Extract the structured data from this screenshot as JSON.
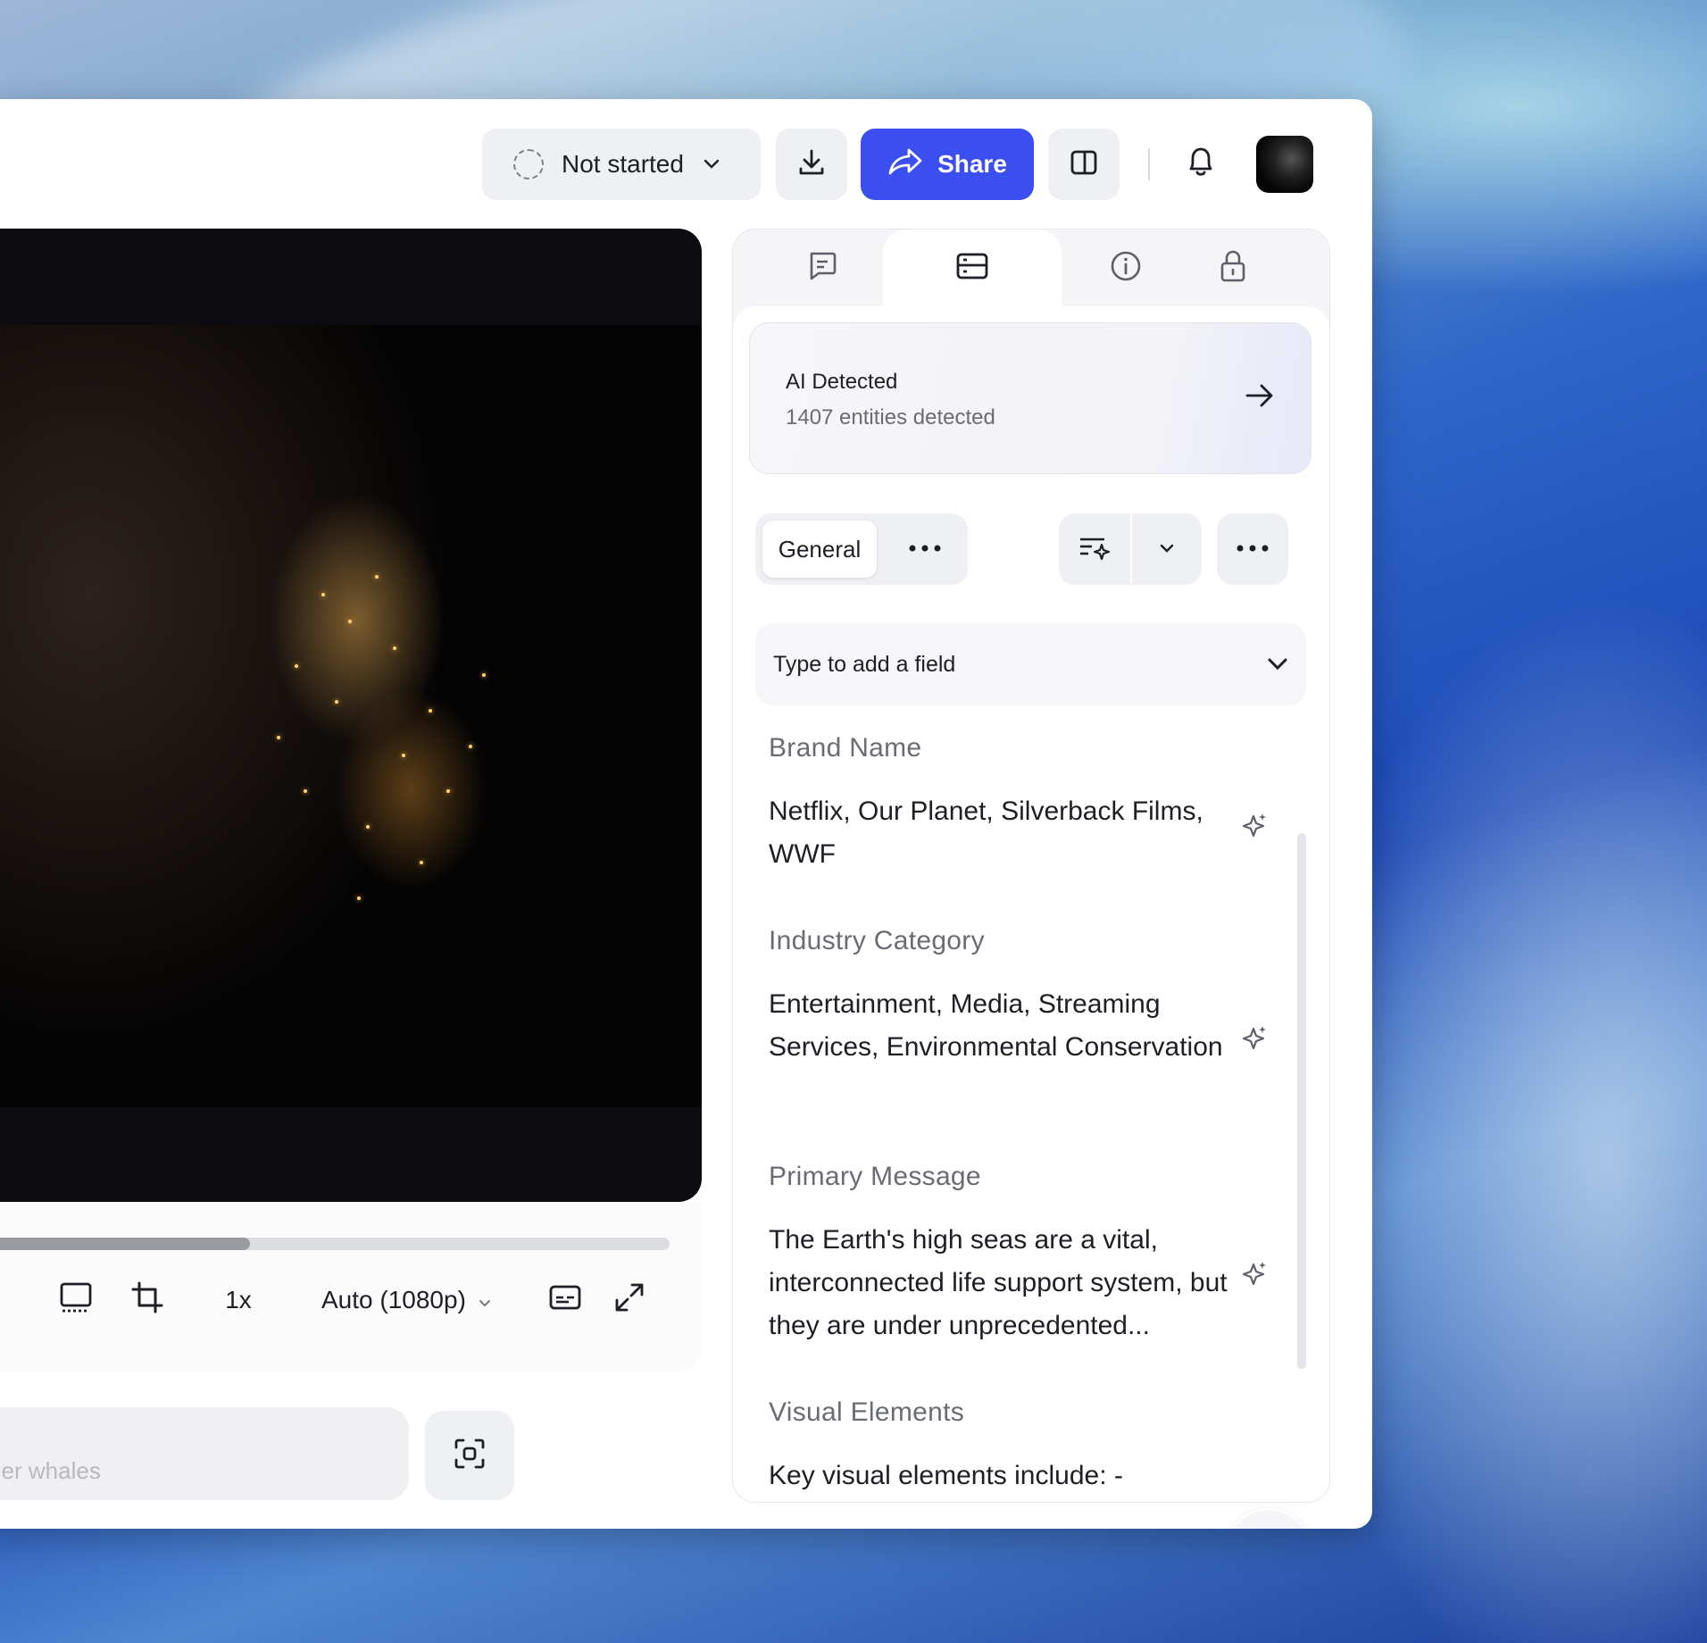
{
  "toolbar": {
    "status_label": "Not started",
    "share_label": "Share"
  },
  "player": {
    "progress_fraction": 0.39,
    "speed_label": "1x",
    "quality_label": "Auto (1080p)"
  },
  "search": {
    "partial_text": "ller whales"
  },
  "panel": {
    "ai_card": {
      "title": "AI Detected",
      "subtitle": "1407 entities detected"
    },
    "segment": {
      "active_label": "General"
    },
    "field_select_placeholder": "Type to add a field",
    "fields": [
      {
        "label": "Brand Name",
        "value": "Netflix, Our Planet, Silverback Films, WWF"
      },
      {
        "label": "Industry Category",
        "value": "Entertainment, Media, Streaming Services, Environmental Conservation"
      },
      {
        "label": "Primary Message",
        "value": "The Earth's high seas are a vital, interconnected life support system, but they are under unprecedented..."
      },
      {
        "label": "Visual Elements",
        "value": "Key visual elements include: -"
      }
    ]
  },
  "colors": {
    "accent": "#3b4ff0",
    "panel_bg": "#f5f5f8"
  }
}
